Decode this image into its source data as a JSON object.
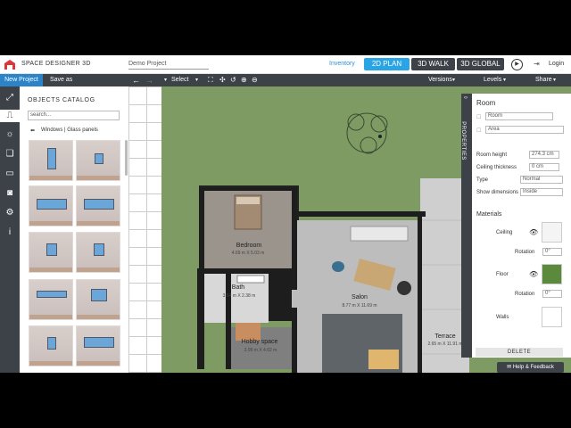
{
  "brand": "SPACE DESIGNER 3D",
  "project_name": "Demo Project",
  "topbar": {
    "inventory": "Inventory",
    "view_2d_plan": "2D PLAN",
    "view_3d_walk": "3D WALK",
    "view_3d_global": "3D GLOBAL",
    "login": "Login"
  },
  "toolbar": {
    "new_project": "New Project",
    "save_as": "Save as",
    "select": "Select",
    "versions": "Versions",
    "levels": "Levels",
    "share": "Share"
  },
  "catalog": {
    "title": "OBJECTS CATALOG",
    "search_placeholder": "search...",
    "category": "Windows | Glass panels"
  },
  "rooms": {
    "bedroom": {
      "name": "Bedroom",
      "dims": "4.69 m X 5.03 m"
    },
    "bath": {
      "name": "Bath",
      "dims": "3.64 m X 2.38 m"
    },
    "hobby": {
      "name": "Hobby space",
      "dims": "3.99 m X 4.62 m"
    },
    "salon": {
      "name": "Salon",
      "dims": "8.77 m X 11.69 m"
    },
    "terrace": {
      "name": "Terrace",
      "dims": "2.65 m X 11.91 m"
    }
  },
  "properties": {
    "tab_label": "PROPERTIES",
    "heading": "Room",
    "name_placeholder": "Room",
    "area_placeholder": "Area",
    "room_height_label": "Room height",
    "room_height_value": "274.3 cm",
    "ceiling_thickness_label": "Ceiling thickness",
    "ceiling_thickness_value": "0 cm",
    "type_label": "Type",
    "type_value": "Normal",
    "show_dimensions_label": "Show dimensions",
    "show_dimensions_value": "Inside",
    "materials_heading": "Materials",
    "ceiling_label": "Ceiling",
    "rotation_label": "Rotation",
    "ceiling_rotation": "0°",
    "floor_label": "Floor",
    "floor_rotation": "0°",
    "walls_label": "Walls",
    "delete_label": "DELETE",
    "ceiling_color": "#f4f4f4",
    "floor_color": "#5c8a3c"
  },
  "help_label": "Help & Feedback",
  "accent_color": "#2b84c8"
}
